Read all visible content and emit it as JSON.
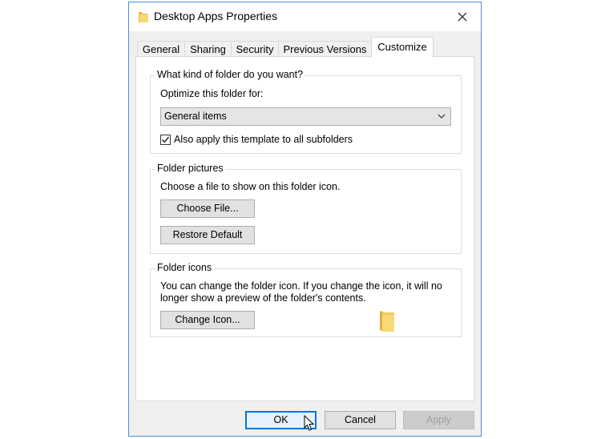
{
  "window": {
    "title": "Desktop Apps Properties"
  },
  "tabs": [
    {
      "label": "General"
    },
    {
      "label": "Sharing"
    },
    {
      "label": "Security"
    },
    {
      "label": "Previous Versions"
    },
    {
      "label": "Customize",
      "active": true
    }
  ],
  "folder_kind": {
    "legend": "What kind of folder do you want?",
    "optimize_label": "Optimize this folder for:",
    "selected_option": "General items",
    "apply_subfolders_label": "Also apply this template to all subfolders",
    "apply_subfolders_checked": true
  },
  "folder_pictures": {
    "legend": "Folder pictures",
    "description": "Choose a file to show on this folder icon.",
    "choose_file_label": "Choose File...",
    "restore_default_label": "Restore Default"
  },
  "folder_icons": {
    "legend": "Folder icons",
    "description_line1": "You can change the folder icon. If you change the icon, it will no",
    "description_line2": "longer show a preview of the folder's contents.",
    "change_icon_label": "Change Icon..."
  },
  "footer": {
    "ok_label": "OK",
    "cancel_label": "Cancel",
    "apply_label": "Apply"
  },
  "colors": {
    "window_border": "#4a90d9",
    "folder_yellow": "#f6d365",
    "default_button_border": "#0078d7"
  }
}
